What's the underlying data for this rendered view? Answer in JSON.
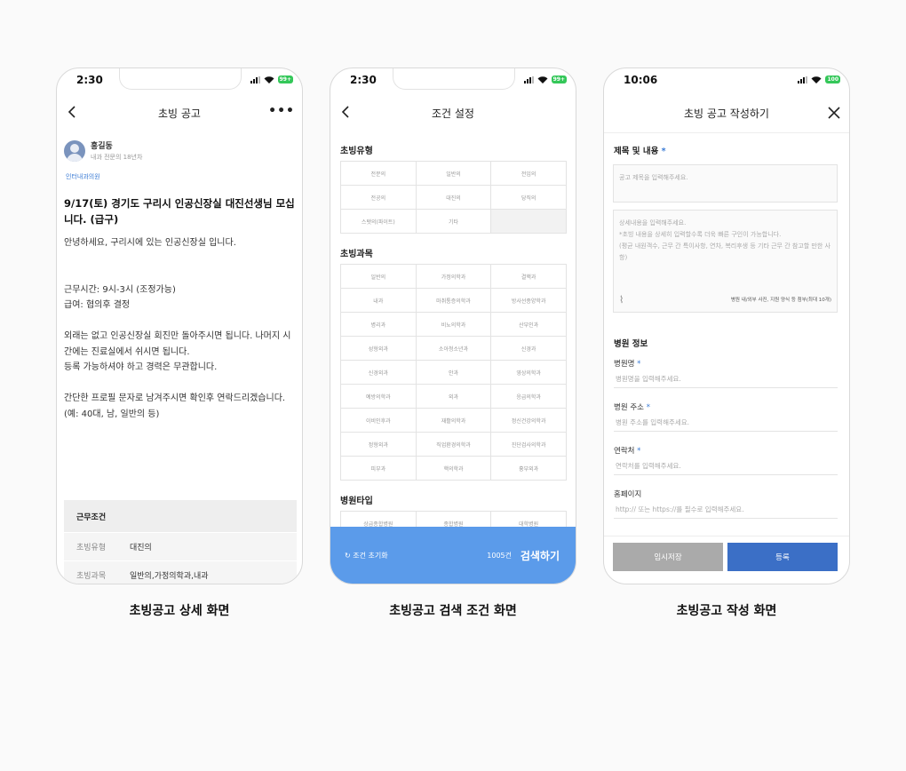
{
  "screens": [
    {
      "status": {
        "time": "2:30",
        "battery": "99+"
      },
      "nav_title": "초빙 공고",
      "more_label": "•••",
      "profile": {
        "name": "홍길동",
        "sub": "내과 전문의 18년차"
      },
      "hospital_tag": "인터내과의원",
      "post_title": "9/17(토) 경기도 구리시 인공신장실 대진선생님 모십니다. (급구)",
      "post_body": "안녕하세요, 구리시에 있는 인공신장실 입니다.\n\n\n근무시간: 9시-3시 (조정가능)\n급여: 협의후 결정\n\n외래는 없고 인공신장실 회진만 돌아주시면 됩니다. 나머지 시간에는 진료실에서 쉬시면 됩니다.\n등록 가능하셔야 하고 경력은 무관합니다.\n\n간단한 프로필 문자로 남겨주시면 확인후 연락드리겠습니다.\n(예: 40대, 남, 일반의 등)",
      "conditions": {
        "header": "근무조건",
        "rows": [
          {
            "key": "초빙유형",
            "value": "대진의"
          },
          {
            "key": "초빙과목",
            "value": "일반의,가정의학과,내과"
          }
        ]
      },
      "caption": "초빙공고 상세 화면"
    },
    {
      "status": {
        "time": "2:30",
        "battery": "99+"
      },
      "nav_title": "조건 설정",
      "section_type": "초빙유형",
      "types": [
        "전문의",
        "일반의",
        "전임의",
        "전공의",
        "대진의",
        "당직의",
        "스탯의(파이트)",
        "기타",
        ""
      ],
      "section_dept": "초빙과목",
      "depts": [
        "일반의",
        "가정의학과",
        "결핵과",
        "내과",
        "마취통증의학과",
        "방사선종양학과",
        "병리과",
        "비뇨의학과",
        "산부인과",
        "성형외과",
        "소아청소년과",
        "신경과",
        "신경외과",
        "안과",
        "영상의학과",
        "예방의학과",
        "외과",
        "응급의학과",
        "이비인후과",
        "재활의학과",
        "정신건강의학과",
        "정형외과",
        "직업환경의학과",
        "진단검사의학과",
        "피부과",
        "핵의학과",
        "흉부외과"
      ],
      "section_hosp": "병원타입",
      "hosp_types": [
        "상급종합병원",
        "종합병원",
        "대학병원"
      ],
      "reset_label": "조건 초기화",
      "count_label": "1005건",
      "search_label": "검색하기",
      "caption": "초빙공고 검색 조건 화면"
    },
    {
      "status": {
        "time": "10:06",
        "battery": "100"
      },
      "nav_title": "초빙 공고 작성하기",
      "label_title": "제목 및 내용",
      "required_mark": "*",
      "title_placeholder": "공고 제목을 입력해주세요.",
      "body_placeholder": "상세내용을 입력해주세요.\n*초빙 내용을 상세히 입력할수록 더욱 빠른 구인이 가능합니다.\n(평균 내원객수, 근무 간 특이사항, 연차, 복리후생 등 기타 근무 간 참고할 만한 사항)",
      "attach_note": "병원 내/외부 사진, 지원 양식 등 첨부(최대 10개)",
      "label_hosp": "병원 정보",
      "fields": [
        {
          "label": "병원명",
          "placeholder": "병원명을 입력해주세요."
        },
        {
          "label": "병원 주소",
          "placeholder": "병원 주소를 입력해주세요."
        },
        {
          "label": "연락처",
          "placeholder": "연락처를 입력해주세요."
        },
        {
          "label": "홈페이지",
          "placeholder": "http:// 또는 https://를 필수로 입력해주세요."
        }
      ],
      "save_label": "임시저장",
      "register_label": "등록",
      "caption": "초빙공고 작성 화면"
    }
  ]
}
